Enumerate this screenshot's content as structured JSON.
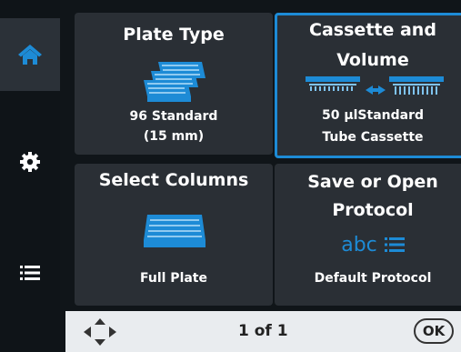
{
  "tiles": {
    "plate_type": {
      "title": "Plate Type",
      "line1": "96 Standard",
      "line2": "(15 mm)"
    },
    "cassette": {
      "title_line1": "Cassette and",
      "title_line2": "Volume",
      "line1": "50 µlStandard",
      "line2": "Tube Cassette"
    },
    "columns": {
      "title": "Select Columns",
      "line1": "Full Plate"
    },
    "protocol": {
      "title_line1": "Save or Open",
      "title_line2": "Protocol",
      "abc": "abc",
      "line1": "Default Protocol"
    }
  },
  "footer": {
    "page": "1 of 1",
    "ok": "OK"
  },
  "colors": {
    "accent": "#1d8bd6",
    "tile_bg": "#2a2f35",
    "footer_bg": "#e9ecef"
  },
  "icons": [
    "home-icon",
    "gear-icon",
    "list-icon",
    "plate-stack-icon",
    "cassette-volume-icon",
    "plate-icon",
    "abc-list-icon",
    "nav-arrows-icon"
  ]
}
